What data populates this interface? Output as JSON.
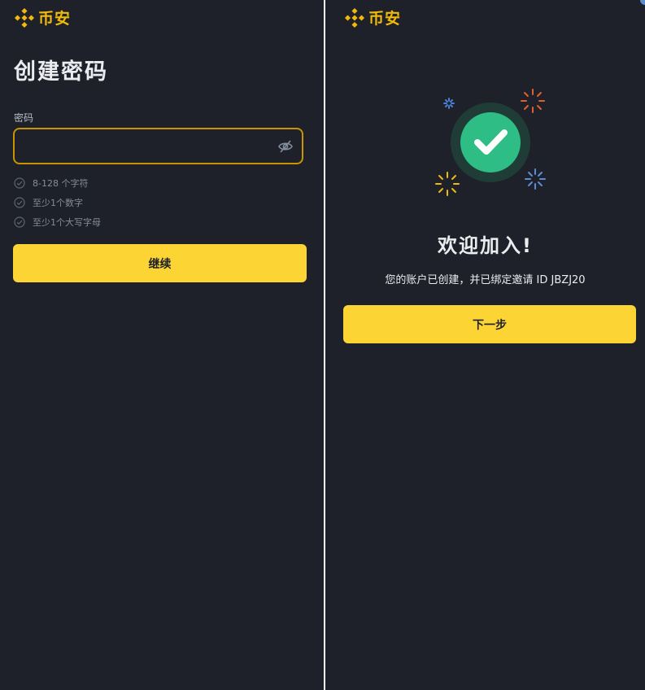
{
  "colors": {
    "background": "#1e2129",
    "brand": "#f0b90b",
    "button": "#fcd535",
    "success": "#2ebd85",
    "text": "#eaecef",
    "muted": "#848e9c"
  },
  "left": {
    "logo": {
      "icon": "binance-logo-icon",
      "text": "币安"
    },
    "title": "创建密码",
    "password": {
      "label": "密码",
      "value": "",
      "placeholder": "",
      "toggle_icon": "eye-slash-icon"
    },
    "rules": [
      {
        "text": "8-128 个字符",
        "icon": "check-circle-icon"
      },
      {
        "text": "至少1个数字",
        "icon": "check-circle-icon"
      },
      {
        "text": "至少1个大写字母",
        "icon": "check-circle-icon"
      }
    ],
    "continue_label": "继续"
  },
  "right": {
    "logo": {
      "icon": "binance-logo-icon",
      "text": "币安"
    },
    "success_icon": "checkmark-success-icon",
    "welcome": "欢迎加入!",
    "description": "您的账户已创建，并已绑定邀请 ID JBZJ20",
    "next_label": "下一步"
  }
}
